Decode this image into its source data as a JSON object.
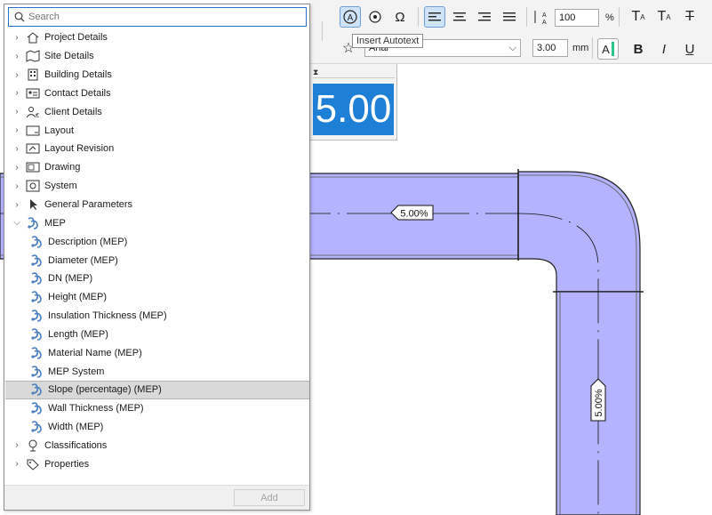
{
  "search": {
    "placeholder": "Search",
    "value": ""
  },
  "tree": [
    {
      "label": "Project Details",
      "expanded": false,
      "icon": "house-icon"
    },
    {
      "label": "Site Details",
      "expanded": false,
      "icon": "site-map-icon"
    },
    {
      "label": "Building Details",
      "expanded": false,
      "icon": "building-icon"
    },
    {
      "label": "Contact Details",
      "expanded": false,
      "icon": "contact-card-icon"
    },
    {
      "label": "Client Details",
      "expanded": false,
      "icon": "client-icon"
    },
    {
      "label": "Layout",
      "expanded": false,
      "icon": "layout-icon"
    },
    {
      "label": "Layout Revision",
      "expanded": false,
      "icon": "layout-revision-icon"
    },
    {
      "label": "Drawing",
      "expanded": false,
      "icon": "drawing-icon"
    },
    {
      "label": "System",
      "expanded": false,
      "icon": "system-icon"
    },
    {
      "label": "General Parameters",
      "expanded": false,
      "icon": "cursor-arrow-icon"
    },
    {
      "label": "MEP",
      "expanded": true,
      "icon": "mep-icon"
    },
    {
      "label": "Description (MEP)",
      "child": true,
      "icon": "mep-icon"
    },
    {
      "label": "Diameter (MEP)",
      "child": true,
      "icon": "mep-icon"
    },
    {
      "label": "DN (MEP)",
      "child": true,
      "icon": "mep-icon"
    },
    {
      "label": "Height (MEP)",
      "child": true,
      "icon": "mep-icon"
    },
    {
      "label": "Insulation Thickness (MEP)",
      "child": true,
      "icon": "mep-icon"
    },
    {
      "label": "Length (MEP)",
      "child": true,
      "icon": "mep-icon"
    },
    {
      "label": "Material Name (MEP)",
      "child": true,
      "icon": "mep-icon"
    },
    {
      "label": "MEP System",
      "child": true,
      "icon": "mep-icon"
    },
    {
      "label": "Slope (percentage) (MEP)",
      "child": true,
      "selected": true,
      "icon": "mep-icon"
    },
    {
      "label": "Wall Thickness (MEP)",
      "child": true,
      "icon": "mep-icon"
    },
    {
      "label": "Width (MEP)",
      "child": true,
      "icon": "mep-icon"
    },
    {
      "label": "Classifications",
      "expanded": false,
      "icon": "classification-tree-icon"
    },
    {
      "label": "Properties",
      "expanded": false,
      "icon": "properties-tag-icon"
    }
  ],
  "footer": {
    "add_label": "Add"
  },
  "toolbar": {
    "tooltip": "Insert Autotext",
    "scale_value": "100",
    "scale_unit": "%",
    "font_name": "Arial",
    "size_value": "3.00",
    "size_unit": "mm",
    "bold_label": "B",
    "italic_label": "I",
    "strike_label": "T"
  },
  "preview": {
    "value": "5.00"
  },
  "drawing": {
    "duct_fill": "#b3b3ff",
    "slope_label_horizontal": "5.00%",
    "slope_label_vertical": "5.00%"
  },
  "colors": {
    "accent": "#1e7fd6",
    "selection": "#d9d9d9"
  }
}
